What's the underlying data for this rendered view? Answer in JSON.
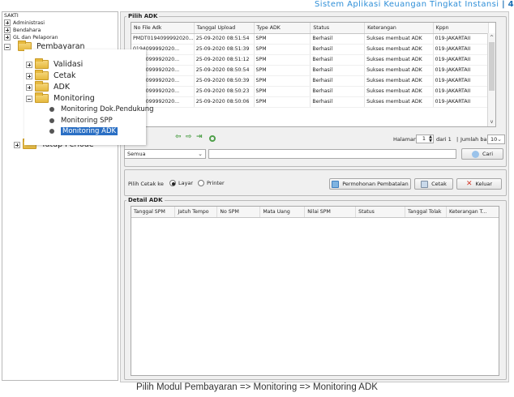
{
  "header": {
    "title": "Sistem Aplikasi Keuangan Tingkat Instansi",
    "separator": "|",
    "page": "4"
  },
  "tree": {
    "root": "SAKTI",
    "items": [
      "Administrasi",
      "Bendahara",
      "GL dan Pelaporan",
      "Pembayaran",
      "Validasi",
      "Cetak",
      "ADK",
      "Monitoring",
      "Monitoring Dok.Pendukung",
      "Monitoring SPP",
      "Monitoring ADK",
      "Tutup Periode"
    ]
  },
  "pilih_adk": {
    "legend": "Pilih ADK",
    "columns": [
      "No File Adk",
      "Tanggal Upload",
      "Type ADK",
      "Status",
      "Keterangan",
      "Kppn"
    ],
    "rows": [
      [
        "PMDT0194099992020...",
        "25-09-2020 08:51:54",
        "SPM",
        "Berhasil",
        "Sukses membuat ADK",
        "019-JAKARTAII"
      ],
      [
        "0194099992020...",
        "25-09-2020 08:51:39",
        "SPM",
        "Berhasil",
        "Sukses membuat ADK",
        "019-JAKARTAII"
      ],
      [
        "0194099992020...",
        "25-09-2020 08:51:12",
        "SPM",
        "Berhasil",
        "Sukses membuat ADK",
        "019-JAKARTAII"
      ],
      [
        "0194099992020...",
        "25-09-2020 08:50:54",
        "SPM",
        "Berhasil",
        "Sukses membuat ADK",
        "019-JAKARTAII"
      ],
      [
        "0194099992020...",
        "25-09-2020 08:50:39",
        "SPM",
        "Berhasil",
        "Sukses membuat ADK",
        "019-JAKARTAII"
      ],
      [
        "0194099992020...",
        "25-09-2020 08:50:23",
        "SPM",
        "Berhasil",
        "Sukses membuat ADK",
        "019-JAKARTAII"
      ],
      [
        "0194099992020...",
        "25-09-2020 08:50:06",
        "SPM",
        "Berhasil",
        "Sukses membuat ADK",
        "019-JAKARTAII"
      ]
    ],
    "pagination": {
      "halaman_label": "Halaman",
      "halaman_value": "1",
      "dari_label": "dari 1",
      "separator": "|",
      "jumlah_label": "Jumlah baris:",
      "jumlah_value": "10"
    },
    "filter_value": "Semua",
    "cari_label": "Cari"
  },
  "print_options": {
    "label": "Pilih Cetak ke",
    "options": [
      "Layar",
      "Printer"
    ],
    "selected": "Layar",
    "buttons": {
      "permohonan": "Permohonan Pembatalan",
      "cetak": "Cetak",
      "keluar": "Keluar"
    }
  },
  "detail_adk": {
    "legend": "Detail ADK",
    "columns": [
      "Tanggal SPM",
      "Jatuh Tempo",
      "No SPM",
      "Mata Uang",
      "Nilai SPM",
      "Status",
      "Tanggal Tolak",
      "Keterangan T..."
    ]
  },
  "caption": "Pilih Modul Pembayaran => Monitoring => Monitoring ADK"
}
